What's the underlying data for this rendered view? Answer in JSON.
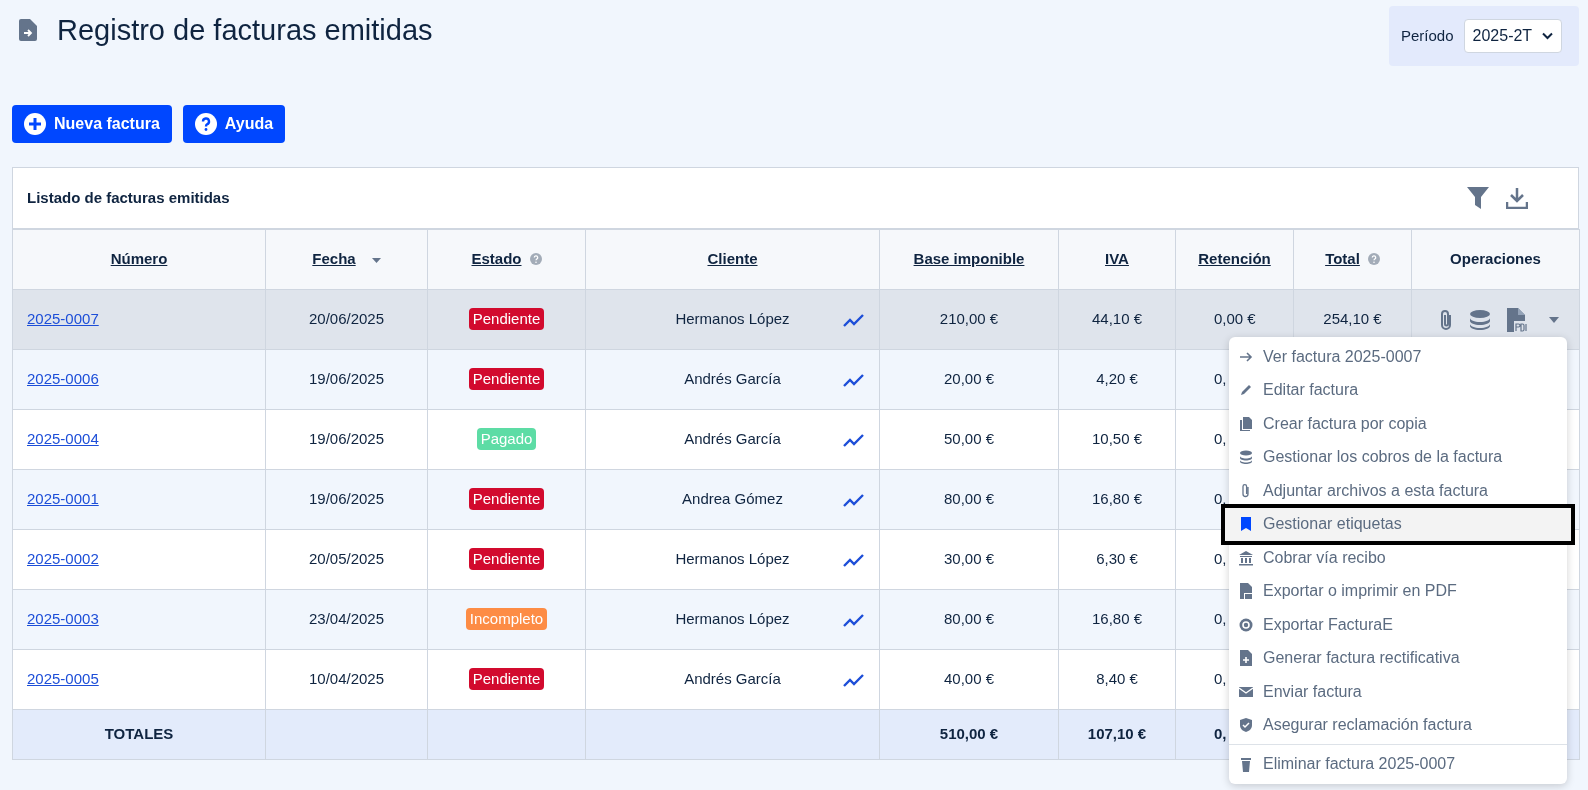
{
  "page": {
    "title": "Registro de facturas emitidas"
  },
  "period": {
    "label": "Período",
    "value": "2025-2T"
  },
  "actions": [
    {
      "kind": "add",
      "label": "Nueva factura"
    },
    {
      "kind": "help",
      "label": "Ayuda"
    }
  ],
  "table": {
    "title": "Listado de facturas emitidas",
    "columns": [
      {
        "label": "Número",
        "kind": "link"
      },
      {
        "label": "Fecha",
        "kind": "sorted"
      },
      {
        "label": "Estado",
        "kind": "info"
      },
      {
        "label": "Cliente",
        "kind": "link"
      },
      {
        "label": "Base imponible",
        "kind": "link"
      },
      {
        "label": "IVA",
        "kind": "link"
      },
      {
        "label": "Retención",
        "kind": "link"
      },
      {
        "label": "Total",
        "kind": "info"
      },
      {
        "label": "Operaciones",
        "kind": "plain"
      }
    ],
    "rows": [
      {
        "selected": true,
        "number": "2025-0007",
        "date": "20/06/2025",
        "status": {
          "label": "Pendiente",
          "color": "#d20a2e"
        },
        "client": "Hermanos López",
        "base": "210,00 €",
        "iva": "44,10 €",
        "retention": "0,00 €",
        "total": "254,10 €"
      },
      {
        "selected": false,
        "number": "2025-0006",
        "date": "19/06/2025",
        "status": {
          "label": "Pendiente",
          "color": "#d20a2e"
        },
        "client": "Andrés García",
        "base": "20,00 €",
        "iva": "4,20 €",
        "retention": "0,"
      },
      {
        "selected": false,
        "number": "2025-0004",
        "date": "19/06/2025",
        "status": {
          "label": "Pagado",
          "color": "#5ddca5"
        },
        "client": "Andrés García",
        "base": "50,00 €",
        "iva": "10,50 €",
        "retention": "0,"
      },
      {
        "selected": false,
        "number": "2025-0001",
        "date": "19/06/2025",
        "status": {
          "label": "Pendiente",
          "color": "#d20a2e"
        },
        "client": "Andrea Gómez",
        "base": "80,00 €",
        "iva": "16,80 €",
        "retention": "0,"
      },
      {
        "selected": false,
        "number": "2025-0002",
        "date": "20/05/2025",
        "status": {
          "label": "Pendiente",
          "color": "#d20a2e"
        },
        "client": "Hermanos López",
        "base": "30,00 €",
        "iva": "6,30 €",
        "retention": "0,"
      },
      {
        "selected": false,
        "number": "2025-0003",
        "date": "23/04/2025",
        "status": {
          "label": "Incompleto",
          "color": "#fd8c45"
        },
        "client": "Hermanos López",
        "base": "80,00 €",
        "iva": "16,80 €",
        "retention": "0,"
      },
      {
        "selected": false,
        "number": "2025-0005",
        "date": "10/04/2025",
        "status": {
          "label": "Pendiente",
          "color": "#d20a2e"
        },
        "client": "Andrés García",
        "base": "40,00 €",
        "iva": "8,40 €",
        "retention": "0,"
      }
    ],
    "totals": {
      "label": "TOTALES",
      "base": "510,00 €",
      "iva": "107,10 €",
      "retention": "0,"
    }
  },
  "menu": [
    {
      "kind": "arrow",
      "label": "Ver factura 2025-0007",
      "highlighted": false
    },
    {
      "kind": "pencil",
      "label": "Editar factura",
      "highlighted": false
    },
    {
      "kind": "copy",
      "label": "Crear factura por copia",
      "highlighted": false
    },
    {
      "kind": "coins",
      "label": "Gestionar los cobros de la factura",
      "highlighted": false
    },
    {
      "kind": "clip",
      "label": "Adjuntar archivos a esta factura",
      "highlighted": false
    },
    {
      "kind": "bookmark",
      "label": "Gestionar etiquetas",
      "highlighted": true
    },
    {
      "kind": "bank",
      "label": "Cobrar vía recibo",
      "highlighted": false
    },
    {
      "kind": "pdf",
      "label": "Exportar o imprimir en PDF",
      "highlighted": false
    },
    {
      "kind": "circle",
      "label": "Exportar FacturaE",
      "highlighted": false
    },
    {
      "kind": "fileplus",
      "label": "Generar factura rectificativa",
      "highlighted": false
    },
    {
      "kind": "mail",
      "label": "Enviar factura",
      "highlighted": false
    },
    {
      "kind": "shield",
      "label": "Asegurar reclamación factura",
      "highlighted": false
    },
    {
      "kind": "trash",
      "label": "Eliminar factura 2025-0007",
      "highlighted": false,
      "separated": true
    }
  ]
}
